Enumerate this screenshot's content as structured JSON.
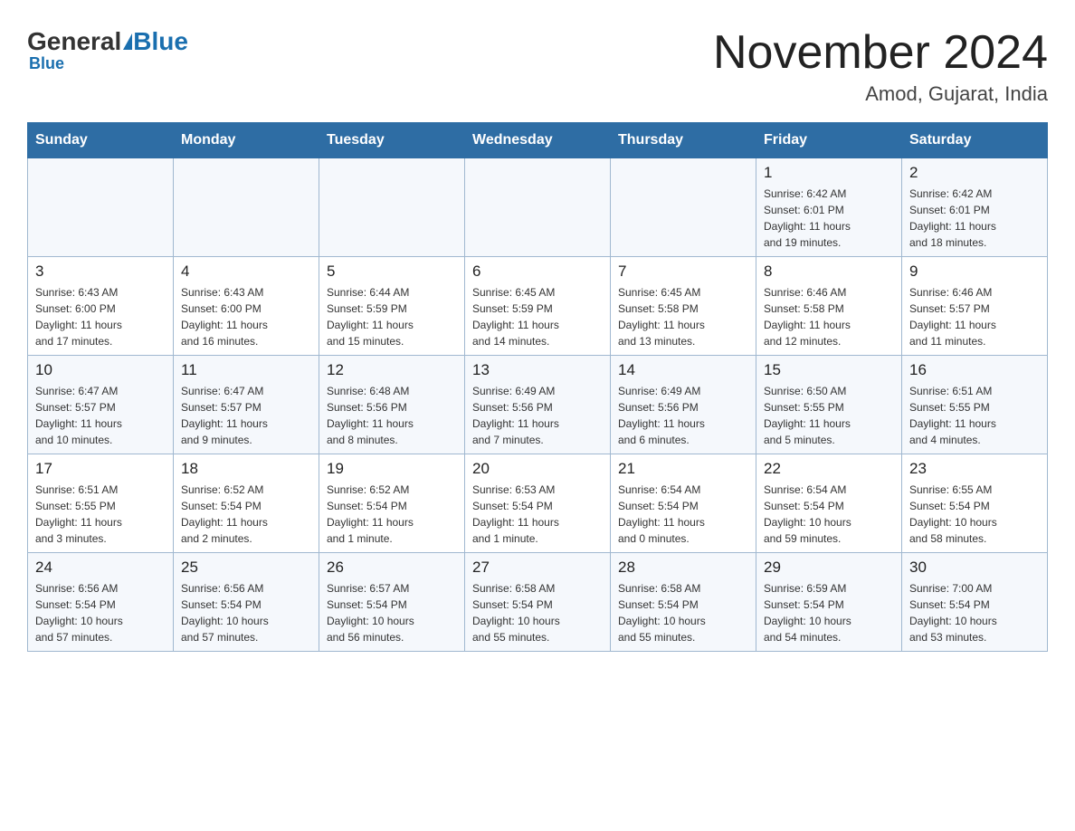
{
  "header": {
    "logo_general": "General",
    "logo_blue": "Blue",
    "title": "November 2024",
    "subtitle": "Amod, Gujarat, India"
  },
  "days_of_week": [
    "Sunday",
    "Monday",
    "Tuesday",
    "Wednesday",
    "Thursday",
    "Friday",
    "Saturday"
  ],
  "weeks": [
    {
      "days": [
        {
          "number": "",
          "info": ""
        },
        {
          "number": "",
          "info": ""
        },
        {
          "number": "",
          "info": ""
        },
        {
          "number": "",
          "info": ""
        },
        {
          "number": "",
          "info": ""
        },
        {
          "number": "1",
          "info": "Sunrise: 6:42 AM\nSunset: 6:01 PM\nDaylight: 11 hours\nand 19 minutes."
        },
        {
          "number": "2",
          "info": "Sunrise: 6:42 AM\nSunset: 6:01 PM\nDaylight: 11 hours\nand 18 minutes."
        }
      ]
    },
    {
      "days": [
        {
          "number": "3",
          "info": "Sunrise: 6:43 AM\nSunset: 6:00 PM\nDaylight: 11 hours\nand 17 minutes."
        },
        {
          "number": "4",
          "info": "Sunrise: 6:43 AM\nSunset: 6:00 PM\nDaylight: 11 hours\nand 16 minutes."
        },
        {
          "number": "5",
          "info": "Sunrise: 6:44 AM\nSunset: 5:59 PM\nDaylight: 11 hours\nand 15 minutes."
        },
        {
          "number": "6",
          "info": "Sunrise: 6:45 AM\nSunset: 5:59 PM\nDaylight: 11 hours\nand 14 minutes."
        },
        {
          "number": "7",
          "info": "Sunrise: 6:45 AM\nSunset: 5:58 PM\nDaylight: 11 hours\nand 13 minutes."
        },
        {
          "number": "8",
          "info": "Sunrise: 6:46 AM\nSunset: 5:58 PM\nDaylight: 11 hours\nand 12 minutes."
        },
        {
          "number": "9",
          "info": "Sunrise: 6:46 AM\nSunset: 5:57 PM\nDaylight: 11 hours\nand 11 minutes."
        }
      ]
    },
    {
      "days": [
        {
          "number": "10",
          "info": "Sunrise: 6:47 AM\nSunset: 5:57 PM\nDaylight: 11 hours\nand 10 minutes."
        },
        {
          "number": "11",
          "info": "Sunrise: 6:47 AM\nSunset: 5:57 PM\nDaylight: 11 hours\nand 9 minutes."
        },
        {
          "number": "12",
          "info": "Sunrise: 6:48 AM\nSunset: 5:56 PM\nDaylight: 11 hours\nand 8 minutes."
        },
        {
          "number": "13",
          "info": "Sunrise: 6:49 AM\nSunset: 5:56 PM\nDaylight: 11 hours\nand 7 minutes."
        },
        {
          "number": "14",
          "info": "Sunrise: 6:49 AM\nSunset: 5:56 PM\nDaylight: 11 hours\nand 6 minutes."
        },
        {
          "number": "15",
          "info": "Sunrise: 6:50 AM\nSunset: 5:55 PM\nDaylight: 11 hours\nand 5 minutes."
        },
        {
          "number": "16",
          "info": "Sunrise: 6:51 AM\nSunset: 5:55 PM\nDaylight: 11 hours\nand 4 minutes."
        }
      ]
    },
    {
      "days": [
        {
          "number": "17",
          "info": "Sunrise: 6:51 AM\nSunset: 5:55 PM\nDaylight: 11 hours\nand 3 minutes."
        },
        {
          "number": "18",
          "info": "Sunrise: 6:52 AM\nSunset: 5:54 PM\nDaylight: 11 hours\nand 2 minutes."
        },
        {
          "number": "19",
          "info": "Sunrise: 6:52 AM\nSunset: 5:54 PM\nDaylight: 11 hours\nand 1 minute."
        },
        {
          "number": "20",
          "info": "Sunrise: 6:53 AM\nSunset: 5:54 PM\nDaylight: 11 hours\nand 1 minute."
        },
        {
          "number": "21",
          "info": "Sunrise: 6:54 AM\nSunset: 5:54 PM\nDaylight: 11 hours\nand 0 minutes."
        },
        {
          "number": "22",
          "info": "Sunrise: 6:54 AM\nSunset: 5:54 PM\nDaylight: 10 hours\nand 59 minutes."
        },
        {
          "number": "23",
          "info": "Sunrise: 6:55 AM\nSunset: 5:54 PM\nDaylight: 10 hours\nand 58 minutes."
        }
      ]
    },
    {
      "days": [
        {
          "number": "24",
          "info": "Sunrise: 6:56 AM\nSunset: 5:54 PM\nDaylight: 10 hours\nand 57 minutes."
        },
        {
          "number": "25",
          "info": "Sunrise: 6:56 AM\nSunset: 5:54 PM\nDaylight: 10 hours\nand 57 minutes."
        },
        {
          "number": "26",
          "info": "Sunrise: 6:57 AM\nSunset: 5:54 PM\nDaylight: 10 hours\nand 56 minutes."
        },
        {
          "number": "27",
          "info": "Sunrise: 6:58 AM\nSunset: 5:54 PM\nDaylight: 10 hours\nand 55 minutes."
        },
        {
          "number": "28",
          "info": "Sunrise: 6:58 AM\nSunset: 5:54 PM\nDaylight: 10 hours\nand 55 minutes."
        },
        {
          "number": "29",
          "info": "Sunrise: 6:59 AM\nSunset: 5:54 PM\nDaylight: 10 hours\nand 54 minutes."
        },
        {
          "number": "30",
          "info": "Sunrise: 7:00 AM\nSunset: 5:54 PM\nDaylight: 10 hours\nand 53 minutes."
        }
      ]
    }
  ]
}
